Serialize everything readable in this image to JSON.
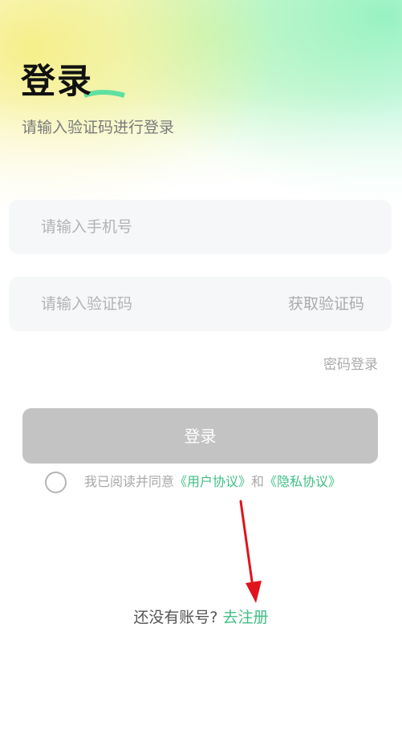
{
  "header": {
    "title": "登录",
    "subtitle": "请输入验证码进行登录"
  },
  "form": {
    "phone_placeholder": "请输入手机号",
    "code_placeholder": "请输入验证码",
    "get_code_label": "获取验证码",
    "password_login_label": "密码登录",
    "login_button_label": "登录"
  },
  "agreement": {
    "prefix": "我已阅读并同意",
    "user_agreement": "《用户协议》",
    "conjunction": "和",
    "privacy_policy": "《隐私协议》"
  },
  "register": {
    "prompt": "还没有账号? ",
    "link": "去注册"
  },
  "colors": {
    "accent_green": "#3fbf84",
    "button_disabled": "#c3c3c3",
    "annotation_arrow": "#e0141b"
  },
  "annotation": {
    "icon": "red-arrow-icon"
  }
}
